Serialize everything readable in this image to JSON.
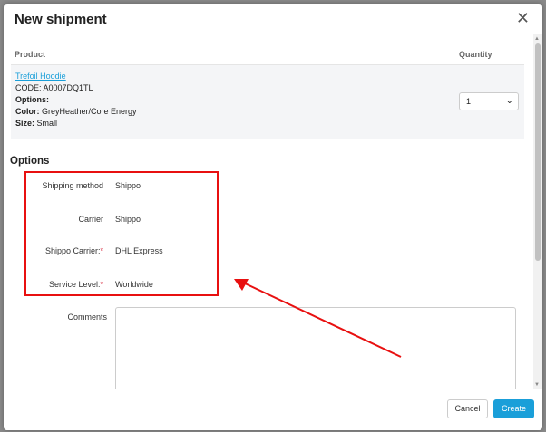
{
  "modal": {
    "title": "New shipment",
    "close_glyph": "✕"
  },
  "table": {
    "col_product": "Product",
    "col_quantity": "Quantity"
  },
  "product": {
    "name": "Trefoil Hoodie",
    "code_label": "CODE:",
    "code": "A0007DQ1TL",
    "options_label": "Options:",
    "color_label": "Color:",
    "color": "GreyHeather/Core Energy",
    "size_label": "Size:",
    "size": "Small",
    "quantity": "1"
  },
  "options": {
    "title": "Options",
    "rows": [
      {
        "label": "Shipping method",
        "required": false,
        "value": "Shippo"
      },
      {
        "label": "Carrier",
        "required": false,
        "value": "Shippo"
      },
      {
        "label": "Shippo Carrier:",
        "required": true,
        "value": "DHL Express"
      },
      {
        "label": "Service Level:",
        "required": true,
        "value": "Worldwide"
      }
    ],
    "required_mark": "*"
  },
  "comments": {
    "label": "Comments",
    "value": ""
  },
  "footer": {
    "cancel_label": "Cancel",
    "create_label": "Create"
  },
  "colors": {
    "accent": "#1a9fd9",
    "annotation": "#e81010",
    "required": "#d0021b"
  }
}
